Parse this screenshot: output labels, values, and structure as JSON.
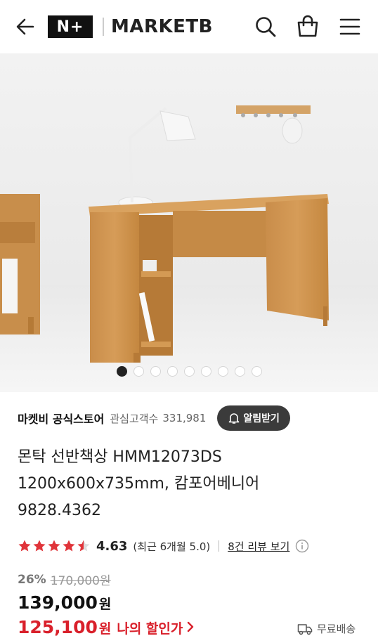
{
  "header": {
    "back_icon": "arrow-left-icon",
    "logo_mark": "N+",
    "logo_text": "MARKETB",
    "search_icon": "search-icon",
    "cart_icon": "shopping-bag-icon",
    "menu_icon": "hamburger-menu-icon"
  },
  "gallery": {
    "total_images": 9,
    "active_index": 0,
    "description_icon": "product-photo"
  },
  "store": {
    "name": "마켓비 공식스토어",
    "fav_label": "관심고객수",
    "fav_count": "331,981",
    "alarm_label": "알림받기",
    "alarm_icon": "bell-plus-icon"
  },
  "product": {
    "title_line1": "몬탁 선반책상 HMM12073DS",
    "title_line2": "1200x600x735mm, 캄포어베니어",
    "title_line3": "9828.4362"
  },
  "rating": {
    "score": "4.63",
    "stars_filled": 4.5,
    "star_color": "#e0343a",
    "recent": "(최근 6개월 5.0)",
    "review_link": "8건 리뷰 보기",
    "info_icon": "info-circle-icon"
  },
  "price": {
    "discount_rate": "26%",
    "original": "170,000원",
    "current": "139,000",
    "current_unit": "원",
    "my_price": "125,100",
    "my_price_unit": "원",
    "my_price_label": "나의 할인가",
    "accent_color": "#d9202b"
  },
  "shipping": {
    "label": "무료배송",
    "icon": "truck-icon"
  }
}
